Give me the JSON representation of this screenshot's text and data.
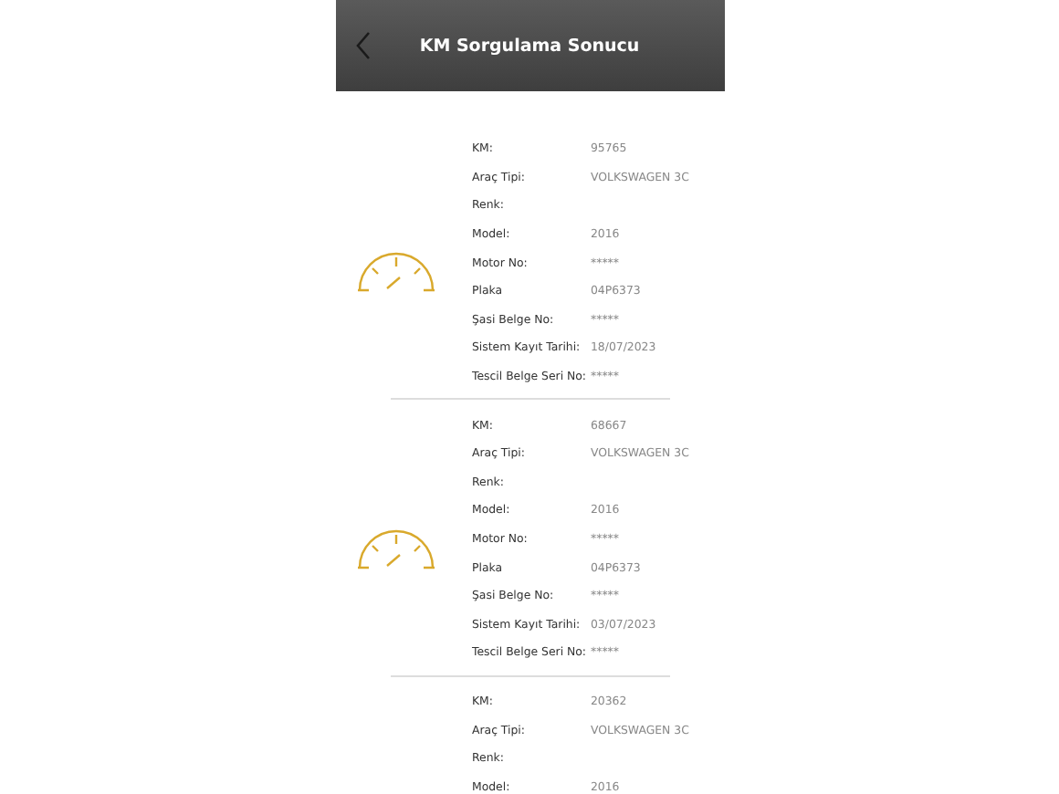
{
  "header": {
    "title": "KM Sorgulama Sonucu"
  },
  "records": [
    {
      "fields": [
        {
          "label": "KM:",
          "value": "95765"
        },
        {
          "label": "Araç Tipi:",
          "value": "VOLKSWAGEN 3C"
        },
        {
          "label": "Renk:"
        },
        {
          "label": "Model:",
          "value": "2016"
        },
        {
          "label": "Motor No:",
          "value": "*****"
        },
        {
          "label": "Plaka",
          "value": "04P6373"
        },
        {
          "label": "Şasi Belge No:",
          "value": "*****"
        },
        {
          "label": "Sistem Kayıt Tarihi:",
          "value": "18/07/2023"
        },
        {
          "label": "Tescil Belge Seri No:",
          "value": "*****"
        }
      ]
    },
    {
      "fields": [
        {
          "label": "KM:",
          "value": "68667"
        },
        {
          "label": "Araç Tipi:",
          "value": "VOLKSWAGEN 3C"
        },
        {
          "label": "Renk:"
        },
        {
          "label": "Model:",
          "value": "2016"
        },
        {
          "label": "Motor No:",
          "value": "*****"
        },
        {
          "label": "Plaka",
          "value": "04P6373"
        },
        {
          "label": "Şasi Belge No:",
          "value": "*****"
        },
        {
          "label": "Sistem Kayıt Tarihi:",
          "value": "03/07/2023"
        },
        {
          "label": "Tescil Belge Seri No:",
          "value": "*****"
        }
      ]
    },
    {
      "fields": [
        {
          "label": "KM:",
          "value": "20362"
        },
        {
          "label": "Araç Tipi:",
          "value": "VOLKSWAGEN 3C"
        },
        {
          "label": "Renk:"
        },
        {
          "label": "Model:",
          "value": "2016"
        }
      ]
    }
  ]
}
